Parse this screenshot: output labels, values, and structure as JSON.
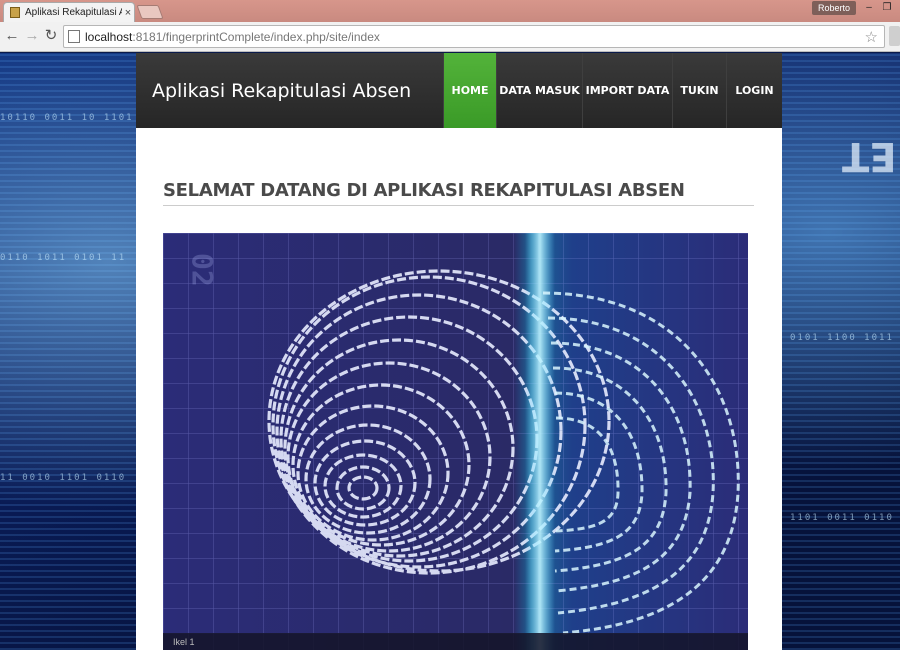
{
  "browser": {
    "tab_title": "Aplikasi Rekapitulasi Absen",
    "tab_close": "×",
    "user": "Roberto",
    "url_host": "localhost",
    "url_path": ":8181/fingerprintComplete/index.php/site/index",
    "minimize": "–",
    "restore": "❐",
    "back_icon": "←",
    "forward_icon": "→",
    "reload_icon": "↻",
    "star_icon": "☆"
  },
  "background": {
    "big_glyphs": "ET"
  },
  "site": {
    "brand": "Aplikasi Rekapitulasi Absen",
    "nav": [
      {
        "label": "HOME",
        "active": true
      },
      {
        "label": "DATA MASUK",
        "active": false
      },
      {
        "label": "IMPORT DATA",
        "active": false
      },
      {
        "label": "TUKIN",
        "active": false
      },
      {
        "label": "LOGIN",
        "active": false
      }
    ],
    "page_title": "SELAMAT DATANG DI APLIKASI REKAPITULASI ABSEN",
    "hero_caption": "Ikel 1",
    "hero_alt": "fingerprint-image"
  },
  "colors": {
    "active_nav": "#4caf35",
    "header_bg": "#2e2e2e",
    "titlebar": "#d0908a"
  }
}
